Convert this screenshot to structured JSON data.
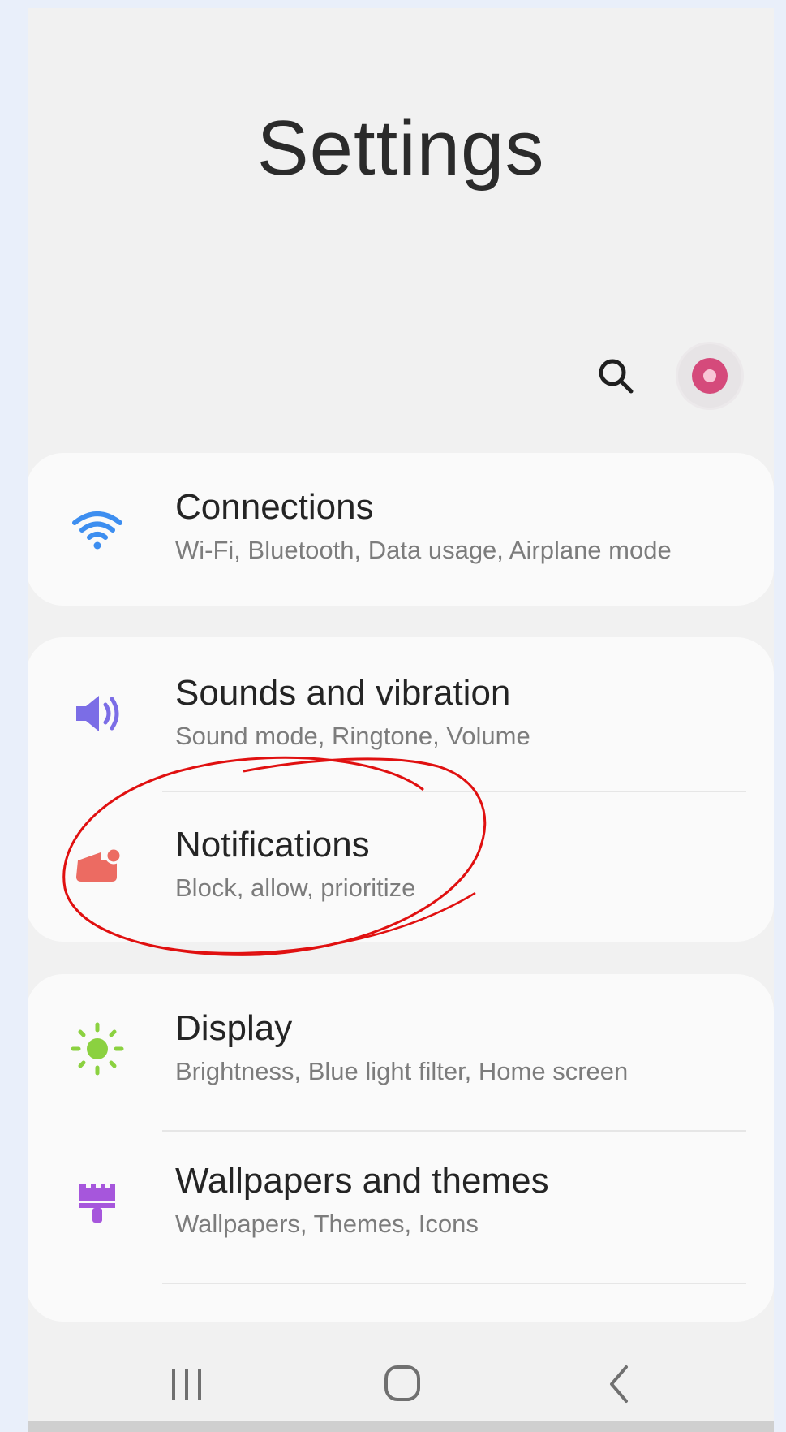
{
  "header": {
    "title": "Settings"
  },
  "toolbar": {
    "search_icon": "search-icon",
    "avatar_icon": "donut-avatar-icon"
  },
  "groups": [
    {
      "items": [
        {
          "label": "Connections",
          "sub": "Wi-Fi, Bluetooth, Data usage, Airplane mode",
          "icon": "wifi-icon",
          "color": "#3d8ef0"
        }
      ]
    },
    {
      "items": [
        {
          "label": "Sounds and vibration",
          "sub": "Sound mode, Ringtone, Volume",
          "icon": "speaker-icon",
          "color": "#7b6de6"
        },
        {
          "label": "Notifications",
          "sub": "Block, allow, prioritize",
          "icon": "notification-icon",
          "color": "#ec6b62"
        }
      ]
    },
    {
      "items": [
        {
          "label": "Display",
          "sub": "Brightness, Blue light filter, Home screen",
          "icon": "sun-icon",
          "color": "#8bd140"
        },
        {
          "label": "Wallpapers and themes",
          "sub": "Wallpapers, Themes, Icons",
          "icon": "paint-brush-icon",
          "color": "#a656dc"
        }
      ]
    }
  ],
  "navigation": {
    "recents_icon": "recent-apps-icon",
    "home_icon": "home-icon",
    "back_icon": "back-icon"
  },
  "annotation": {
    "color": "#e01010",
    "target": "Notifications"
  },
  "colors": {
    "background": "#f1f1f1",
    "card": "#fafafa",
    "page_backdrop": "#e9effa"
  }
}
